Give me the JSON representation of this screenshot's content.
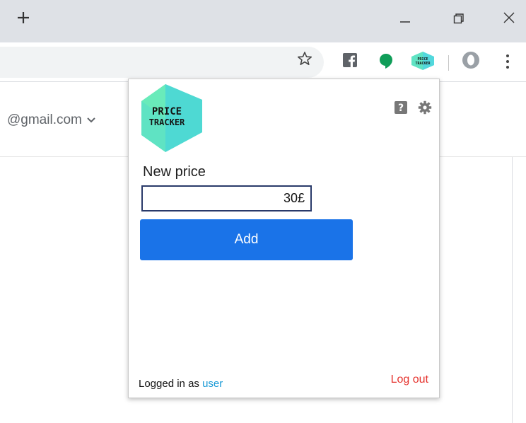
{
  "browser": {
    "new_tab_symbol": "+",
    "window_controls": [
      "minimize-icon",
      "restore-icon",
      "close-icon"
    ],
    "toolbar_icons": [
      "bookmark-star-icon",
      "facebook-icon",
      "chat-bubble-icon",
      "price-tracker-extension-icon",
      "profile-icon",
      "kebab-menu-icon"
    ]
  },
  "page": {
    "account_email": "@gmail.com"
  },
  "popup": {
    "logo_line1": "PRICE",
    "logo_line2": "TRACKER",
    "new_price_label": "New price",
    "price_value": "30£",
    "add_label": "Add",
    "logged_in_prefix": "Logged in as ",
    "username": "user",
    "logout_label": "Log out"
  },
  "colors": {
    "accent_blue": "#1a73e8",
    "link_blue": "#1a9ad6",
    "logout_red": "#e5322d",
    "logo_teal": "#5fe3c3"
  }
}
